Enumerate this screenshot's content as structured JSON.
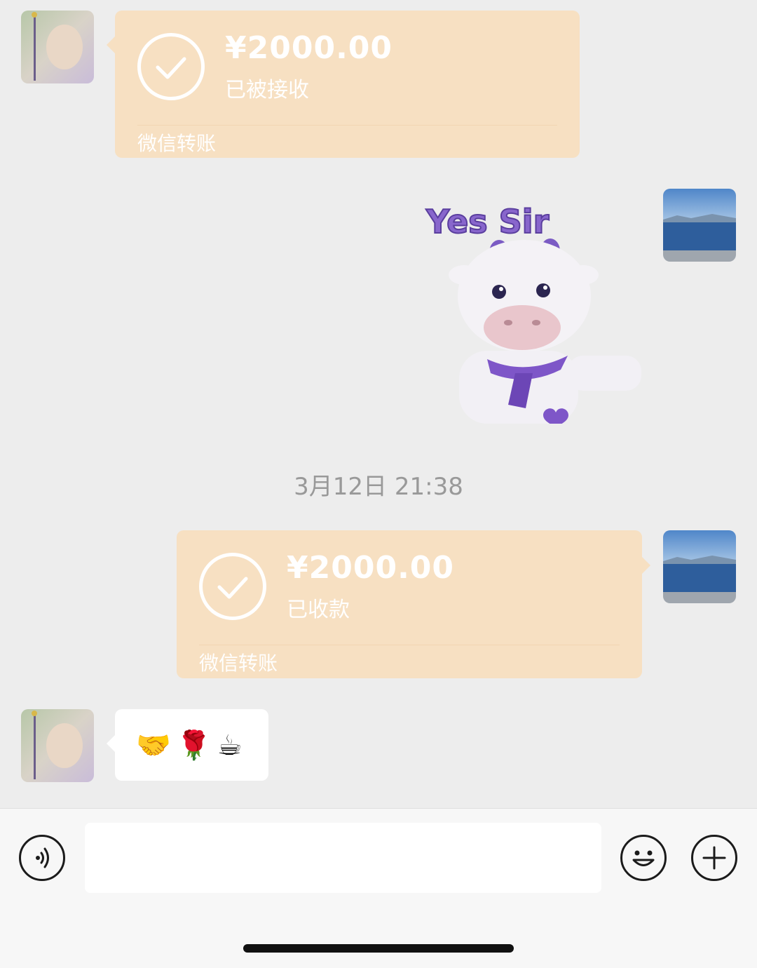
{
  "messages": {
    "transfer_received": {
      "amount": "¥2000.00",
      "status": "已被接收",
      "footer": "微信转账"
    },
    "sticker": {
      "caption": "Yes Sir"
    },
    "timestamp": "3月12日 21:38",
    "transfer_collected": {
      "amount": "¥2000.00",
      "status": "已收款",
      "footer": "微信转账"
    },
    "emoji_message": "🤝🌹☕"
  },
  "input_bar": {
    "placeholder": "",
    "icons": [
      "voice-icon",
      "emoji-icon",
      "plus-icon"
    ]
  },
  "colors": {
    "background": "#EDEDED",
    "transfer_bubble": "#F7E0C2",
    "timestamp": "#999999"
  }
}
